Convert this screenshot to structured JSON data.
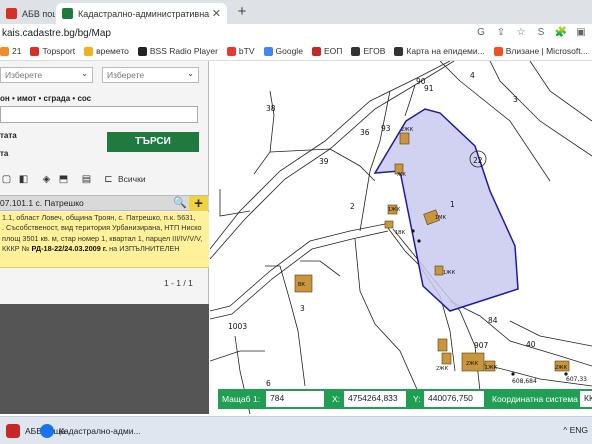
{
  "browser": {
    "tabs": [
      {
        "label": "АБВ поща",
        "favicon_color": "#d93025"
      },
      {
        "label": "Кадастрално-административна",
        "favicon_color": "#1e7a3e"
      }
    ],
    "new_tab": "+",
    "url": "kais.cadastre.bg/bg/Map",
    "addr_icons": [
      "G",
      "⇪",
      "☆",
      "S",
      "🧩",
      "▣"
    ],
    "bookmarks": [
      {
        "label": "21",
        "color": "#f28c28"
      },
      {
        "label": "Topsport",
        "color": "#d93025"
      },
      {
        "label": "времето",
        "color": "#f2b01e"
      },
      {
        "label": "BSS Radio Player",
        "color": "#222222"
      },
      {
        "label": "bTV",
        "color": "#e53935"
      },
      {
        "label": "Google",
        "color": "#4285f4"
      },
      {
        "label": "ЕОП",
        "color": "#c62828"
      },
      {
        "label": "ЕГОВ",
        "color": "#333333"
      },
      {
        "label": "Карта на епидеми...",
        "color": "#333333"
      },
      {
        "label": "Влизане | Microsoft...",
        "color": "#f25022"
      }
    ]
  },
  "panel": {
    "select1": "Изберете",
    "select2": "Изберете",
    "search_hint": "он • имот • сграда • сос",
    "label1": "тата",
    "label2": "та",
    "search_button": "ТЪРСИ",
    "all_label": "Всички",
    "result_header": "07.101.1 с. Патрешко",
    "result_lines": [
      "1.1, област Ловеч, община Троян, с. Патрешко, п.к. 5631,",
      ". Съсобственост, вид територия Урбанизирана, НТП Ниско",
      "площ 3501 кв. м, стар номер 1, квартал 1, парцел III/IV/V/V,",
      "КККР № "
    ],
    "result_bold": "РД-18-22/24.03.2009 г.",
    "result_tail": " на ИЗПЪЛНИТЕЛЕН",
    "pager": "1 - 1 / 1"
  },
  "map": {
    "labels": [
      "38",
      "90",
      "91",
      "4",
      "3",
      "93",
      "36",
      "22",
      "39",
      "1",
      "2",
      "3",
      "84",
      "1003",
      "907",
      "40",
      "6",
      "4754264,833",
      "608,684",
      "607,33"
    ],
    "buildings": [
      "2ЖК",
      "ЖК",
      "1ЖК",
      "1ЖК",
      "1МК",
      "1ЖК",
      "ВК",
      "1ВК",
      "2ЖК",
      "2ЖК",
      "2ЖК",
      "1ЖК"
    ],
    "highlight_color": "#c9c9ee",
    "highlight_stroke": "#1a1aa8",
    "building_color": "#c8963c"
  },
  "mapbar": {
    "scale_label": "Мащаб",
    "scale_ratio": "1:",
    "scale_value": "784",
    "x_label": "X:",
    "x_value": "4754264,833",
    "y_label": "Y:",
    "y_value": "440076,750",
    "crs_label": "Координатна система",
    "crs_value": "КК"
  },
  "taskbar": {
    "items": [
      {
        "label": "АБВ поща",
        "color": "#c62828"
      },
      {
        "label": "Кадастрално-адми...",
        "color": "#1a73e8"
      }
    ],
    "tray": "^  ENG"
  }
}
